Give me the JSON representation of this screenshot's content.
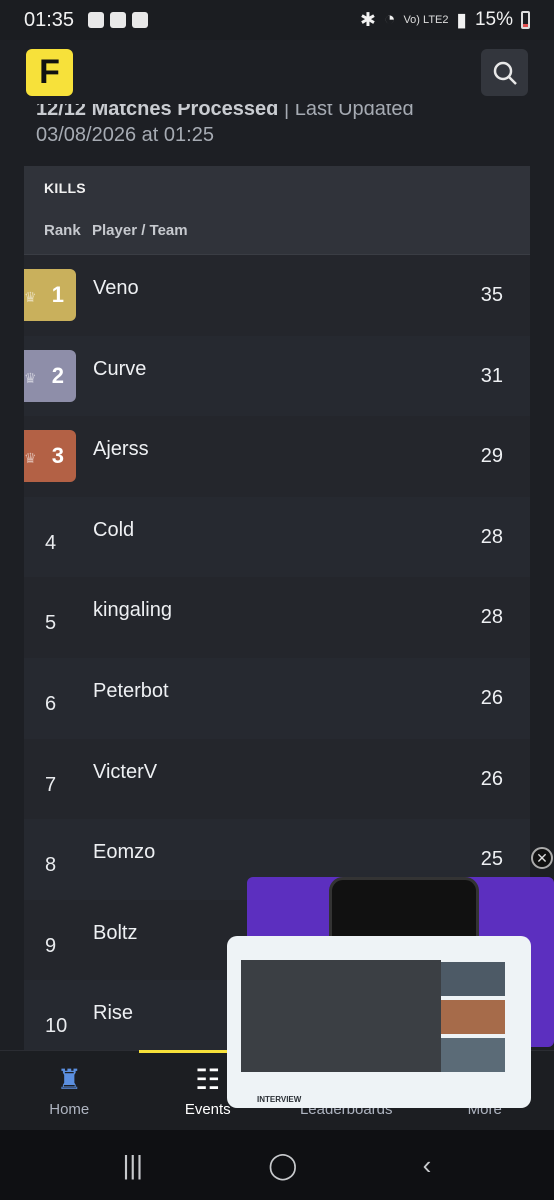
{
  "status": {
    "time": "01:35",
    "battery": "15%",
    "net": "Vo) LTE2"
  },
  "header": {
    "logo": "F"
  },
  "meta": {
    "matches": "12/12 Matches Processed",
    "sep": "|",
    "updated_label": "Last Updated",
    "updated_at": "03/08/2026 at 01:25"
  },
  "table": {
    "title": "KILLS",
    "col_rank": "Rank",
    "col_player": "Player / Team",
    "rows": [
      {
        "rank": "1",
        "player": "Veno",
        "kills": "35"
      },
      {
        "rank": "2",
        "player": "Curve",
        "kills": "31"
      },
      {
        "rank": "3",
        "player": "Ajerss",
        "kills": "29"
      },
      {
        "rank": "4",
        "player": "Cold",
        "kills": "28"
      },
      {
        "rank": "5",
        "player": "kingaling",
        "kills": "28"
      },
      {
        "rank": "6",
        "player": "Peterbot",
        "kills": "26"
      },
      {
        "rank": "7",
        "player": "VicterV",
        "kills": "26"
      },
      {
        "rank": "8",
        "player": "Eomzo",
        "kills": "25"
      },
      {
        "rank": "9",
        "player": "Boltz",
        "kills": ""
      },
      {
        "rank": "10",
        "player": "Rise",
        "kills": ""
      }
    ]
  },
  "nav": {
    "home": "Home",
    "events": "Events",
    "leaderboards": "Leaderboards",
    "more": "More"
  },
  "pip": {
    "bottom_label": "INTERVIEW"
  }
}
